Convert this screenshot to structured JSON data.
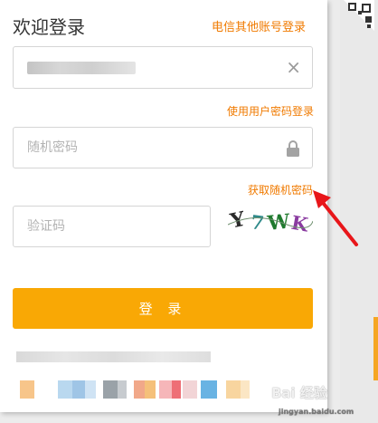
{
  "header": {
    "title": "欢迎登录",
    "other_account_link": "电信其他账号登录"
  },
  "username": {
    "value": "",
    "clear_icon": "×"
  },
  "use_password_link": "使用用户密码登录",
  "password": {
    "placeholder": "随机密码"
  },
  "get_random_password_link": "获取随机密码",
  "captcha": {
    "placeholder": "验证码",
    "image_text": "Y7WK"
  },
  "login_button": "登 录",
  "watermark": {
    "main": "Bai 经验",
    "sub": "jingyan.baidu.com"
  },
  "colors": {
    "accent": "#f9a805",
    "link": "#f07a00",
    "annotation_arrow": "#e8161a"
  },
  "icons": {
    "lock": "lock-icon",
    "qr": "qr-corner-icon",
    "clear": "clear-icon"
  }
}
